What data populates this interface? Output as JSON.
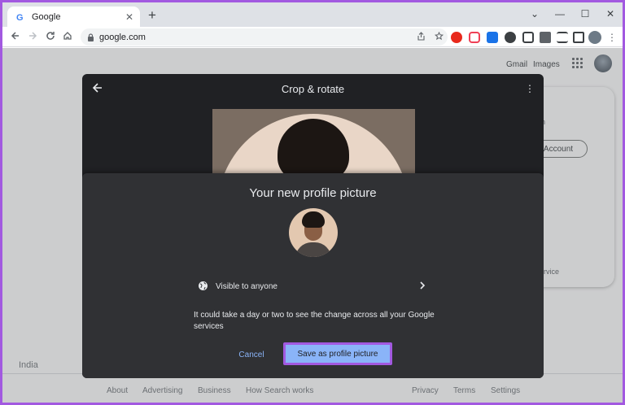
{
  "browser": {
    "tab_title": "Google",
    "new_tab_symbol": "+",
    "tab_close_symbol": "✕",
    "url": "google.com",
    "window_controls": [
      "⌄",
      "—",
      "☐",
      "✕"
    ]
  },
  "google_page": {
    "gmail_label": "Gmail",
    "images_label": "Images",
    "account_fragment_1": "in",
    "account_button_label": "Account",
    "account_fragment_2": "ervice",
    "country": "India",
    "footer_left": [
      "About",
      "Advertising",
      "Business",
      "How Search works"
    ],
    "footer_right": [
      "Privacy",
      "Terms",
      "Settings"
    ]
  },
  "crop_dialog": {
    "title": "Crop & rotate",
    "more_symbol": "⋮"
  },
  "confirm_panel": {
    "title": "Your new profile picture",
    "visibility_label": "Visible to anyone",
    "note": "It could take a day or two to see the change across all your Google services",
    "cancel_label": "Cancel",
    "save_label": "Save as profile picture"
  },
  "colors": {
    "highlight": "#a259e0",
    "dialog_bg": "#202124",
    "panel_bg": "#303134",
    "link_blue": "#8ab4f8"
  }
}
